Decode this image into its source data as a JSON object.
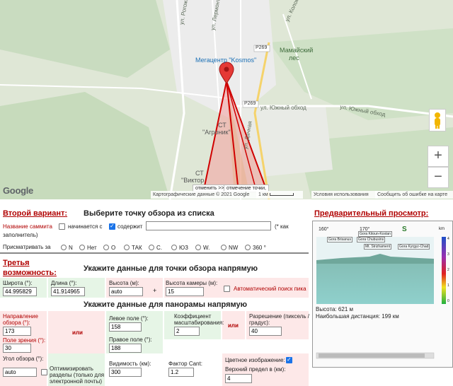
{
  "map": {
    "labels": {
      "street_rogozhinova": "ул. Рогожинова",
      "street_lermontova": "ул. Лермонтова",
      "street_kolokolnikova": "ул. Колокольникова",
      "road_p269_top": "P269",
      "road_p269_mid": "P269",
      "megacenter": "Мегацентр \"Kosmos\"",
      "mamaiskiy_line1": "Мамайский",
      "mamaiskiy_line2": "лес",
      "street_yuzhny_obkhod_1": "ул. Южный обход",
      "street_yuzhny_obkhod_2": "ул. Южный обход",
      "st_agronik_line1": "СТ",
      "st_agronik_line2": "\"Агроник\"",
      "st_viktor_line1": "СТ",
      "st_viktor_line2": "\"Виктор",
      "street_dachnaya": "ул. Дачная"
    },
    "popup_left": "отменить >>",
    "popup_right": "отмечение точки,",
    "google_logo": "Google",
    "attribution": {
      "data": "Картографические данные © 2021 Google",
      "scale": "1 км",
      "terms": "Условия использования",
      "report": "Сообщить об ошибке на карте"
    },
    "zoom_in": "+",
    "zoom_out": "−",
    "colors": {
      "cone_fill": "#f4a0a0",
      "cone_stroke": "#d00000",
      "pin": "#e53935"
    }
  },
  "form": {
    "variant2_title": "Второй вариант:",
    "select_heading": "Выберите точку обзора из списка",
    "summit_name_label": "Название саммита",
    "starts_with_label": "начинается с",
    "contains_label": "содержит",
    "fill_hint": "(* как",
    "fill_hint2": "заполнитель)",
    "look_at_label": "Присматривать за",
    "directions": [
      "N",
      "Нет",
      "О",
      "ТАК",
      "С.",
      "ЮЗ",
      "W.",
      "NW",
      "360 °"
    ],
    "variant3_line1": "Третья",
    "variant3_line2": "возможность:",
    "direct_heading": "Укажите данные для точки обзора напрямую",
    "latitude_label": "Широта (°):",
    "latitude_value": "44.995829",
    "longitude_label": "Длина (°):",
    "longitude_value": "41.914965",
    "height_label": "Высота (м):",
    "height_value": "auto",
    "plus": "+",
    "camera_height_label": "Высота камеры (м):",
    "camera_height_value": "15",
    "auto_peak_label": "Автоматический поиск пика",
    "panorama_heading": "Укажите данные для панорамы напрямую",
    "direction_label_1": "Направление",
    "direction_label_2": "обзора (°):",
    "direction_value": "173",
    "fov_label": "Поле зрения (°):",
    "fov_value": "30",
    "or1": "или",
    "left_field_label": "Левое поле (°):",
    "left_field_value": "158",
    "right_field_label": "Правое поле (°):",
    "right_field_value": "188",
    "scale_label_1": "Коэффициент",
    "scale_label_2": "масштабирования:",
    "scale_value": "2",
    "or2": "или",
    "resolution_label_1": "Разрешение (пиксель /",
    "resolution_label_2": "градус):",
    "resolution_value": "40",
    "view_angle_label": "Угол обзора (°):",
    "view_angle_value": "auto",
    "optimize_label_1": "Оптимизировать",
    "optimize_label_2": "разделы (только для",
    "optimize_label_3": "электронной почты)",
    "visibility_label": "Видимость (км):",
    "visibility_value": "300",
    "cant_label": "Фактор Cant:",
    "cant_value": "1.2",
    "color_image_label": "Цветное изображение:",
    "upper_limit_label": "Верхний предел в (км):",
    "upper_limit_value": "4"
  },
  "preview": {
    "title": "Предварительный просмотр:",
    "deg_left": "160°",
    "deg_mid": "170°",
    "deg_right": "S",
    "unit": "km",
    "peaks": [
      "Gora Kitoun-Kostan",
      "Gora Brisanus",
      "Gora Chubusins",
      "Mt. Strizhament",
      "Gora Kyrgyz-Chad"
    ],
    "height_text": "Высота: 621 м",
    "distance_text": "Наибольшая дистанция: 199 км",
    "scale_ticks": [
      "4",
      "3",
      "2",
      "1",
      "0"
    ]
  }
}
